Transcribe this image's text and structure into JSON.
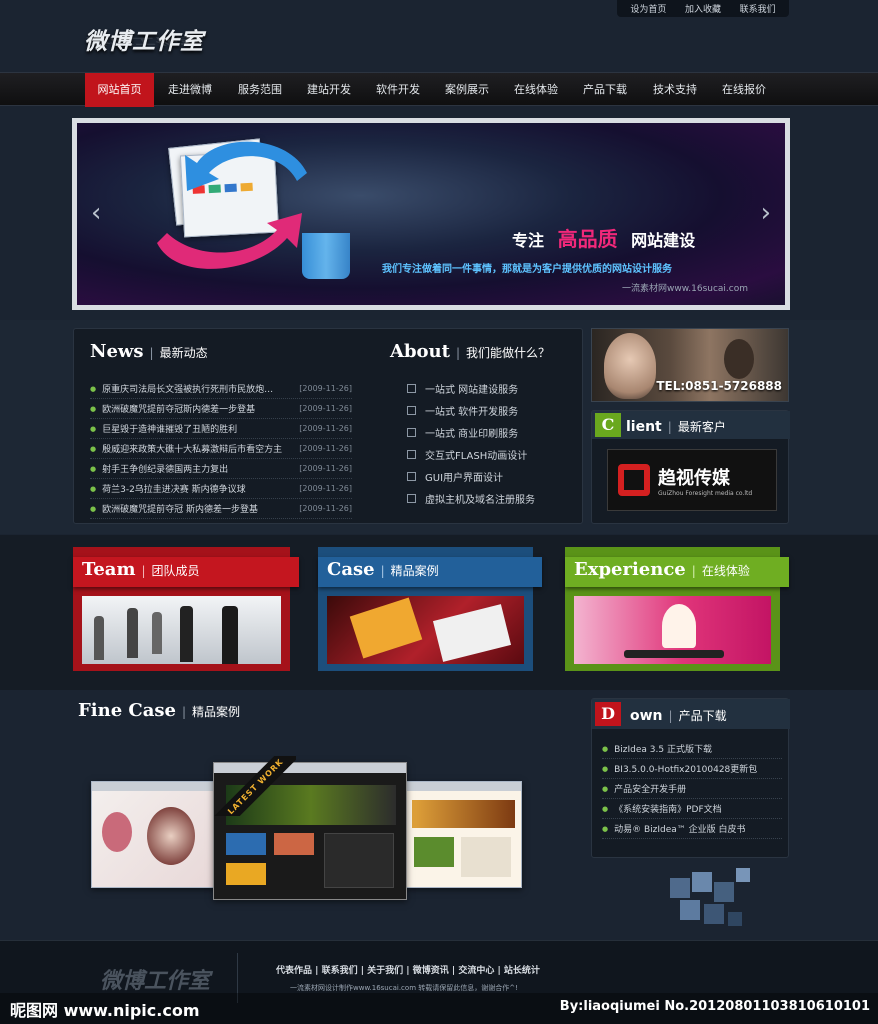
{
  "topbar": {
    "links": [
      "设为首页",
      "加入收藏",
      "联系我们"
    ]
  },
  "logo": {
    "text": "微博工作室"
  },
  "nav": {
    "items": [
      "网站首页",
      "走进微博",
      "服务范围",
      "建站开发",
      "软件开发",
      "案例展示",
      "在线体验",
      "产品下载",
      "技术支持",
      "在线报价"
    ],
    "active_index": 0
  },
  "banner": {
    "title_a": "专注",
    "title_hl": "高品质",
    "title_b": "网站建设",
    "subtitle": "我们专注做着同一件事情，那就是为客户提供优质的网站设计服务",
    "watermark": "一流素材网www.16sucai.com",
    "prev_icon": "chevron-left-icon",
    "next_icon": "chevron-right-icon"
  },
  "news": {
    "title_en": "News",
    "title_cn": "最新动态",
    "items": [
      {
        "title": "原重庆司法局长文强被执行死刑市民放炮…",
        "date": "[2009-11-26]"
      },
      {
        "title": "欧洲破魔咒提前夺冠斯内德差一步登基",
        "date": "[2009-11-26]"
      },
      {
        "title": "巨星毁于造神谁摧毁了丑陋的胜利",
        "date": "[2009-11-26]"
      },
      {
        "title": "殷威迎来政策大礁十大私募激辩后市看空方主",
        "date": "[2009-11-26]"
      },
      {
        "title": "射手王争创纪录德国两主力复出",
        "date": "[2009-11-26]"
      },
      {
        "title": "荷兰3-2乌拉圭进决赛 斯内德争议球",
        "date": "[2009-11-26]"
      },
      {
        "title": "欧洲破魔咒提前夺冠 斯内德差一步登基",
        "date": "[2009-11-26]"
      }
    ]
  },
  "about": {
    "title_en": "About",
    "title_cn": "我们能做什么？",
    "items": [
      "一站式 网站建设服务",
      "一站式 软件开发服务",
      "一站式 商业印刷服务",
      "交互式FLASH动画设计",
      "GUI用户界面设计",
      "虚拟主机及域名注册服务"
    ]
  },
  "contact": {
    "tel": "TEL:0851-5726888"
  },
  "client": {
    "letter": "C",
    "title_en": "lient",
    "title_cn": "最新客户",
    "logo_cn": "趋视传媒",
    "logo_en": "GuiZhou Foresight media co.ltd"
  },
  "cards": [
    {
      "title_en": "Team",
      "title_cn": "团队成员",
      "color": "#b8141c"
    },
    {
      "title_en": "Case",
      "title_cn": "精品案例",
      "color": "#1f5688"
    },
    {
      "title_en": "Experience",
      "title_cn": "在线体验",
      "color": "#5e9a1a"
    }
  ],
  "fine_case": {
    "title_en": "Fine Case",
    "title_cn": "精品案例",
    "ribbon": "LATEST WORK"
  },
  "download": {
    "letter": "D",
    "title_en": "own",
    "title_cn": "产品下载",
    "items": [
      "BizIdea 3.5 正式版下载",
      "BI3.5.0.0-Hotfix20100428更新包",
      "产品安全开发手册",
      "《系统安装指南》PDF文档",
      "动易® BizIdea™ 企业版 白皮书"
    ]
  },
  "footer": {
    "logo": "微博工作室",
    "links": [
      "代表作品",
      "联系我们",
      "关于我们",
      "微博资讯",
      "交流中心",
      "站长统计"
    ],
    "note": "一流素材网设计制作www.16sucai.com 转载请保留此信息，谢谢合作^!",
    "watermark_left": "昵图网 www.nipic.com",
    "watermark_right": "By:liaoqiumei No.20120801103810610101"
  },
  "colors": {
    "accent_red": "#c1141c",
    "bullet_green": "#7cc24a",
    "banner_pink": "#f2287a",
    "banner_blue": "#5ec3ff"
  }
}
